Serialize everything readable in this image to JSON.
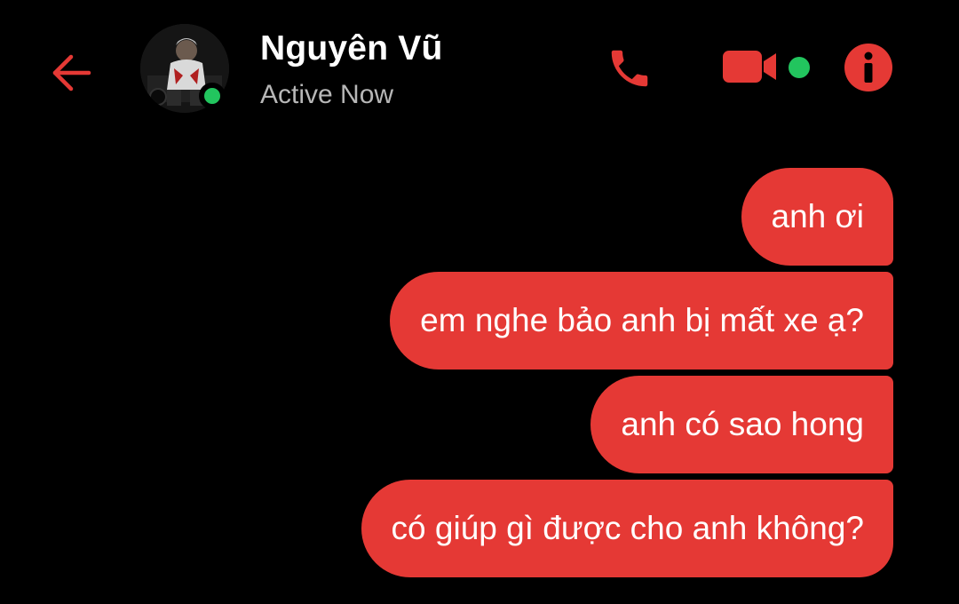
{
  "header": {
    "contact_name": "Nguyên Vũ",
    "status": "Active Now",
    "online": true,
    "icons": {
      "back": "arrow-left-icon",
      "call": "phone-icon",
      "video": "video-camera-icon",
      "info": "info-icon"
    }
  },
  "messages": [
    {
      "text": "anh ơi",
      "sender": "me"
    },
    {
      "text": "em nghe bảo anh bị mất xe ạ?",
      "sender": "me"
    },
    {
      "text": "anh có sao hong",
      "sender": "me"
    },
    {
      "text": "có giúp gì được cho anh không?",
      "sender": "me"
    }
  ],
  "colors": {
    "background": "#000000",
    "accent": "#e53935",
    "online": "#22c55e",
    "status_text": "#b7b7b7"
  }
}
